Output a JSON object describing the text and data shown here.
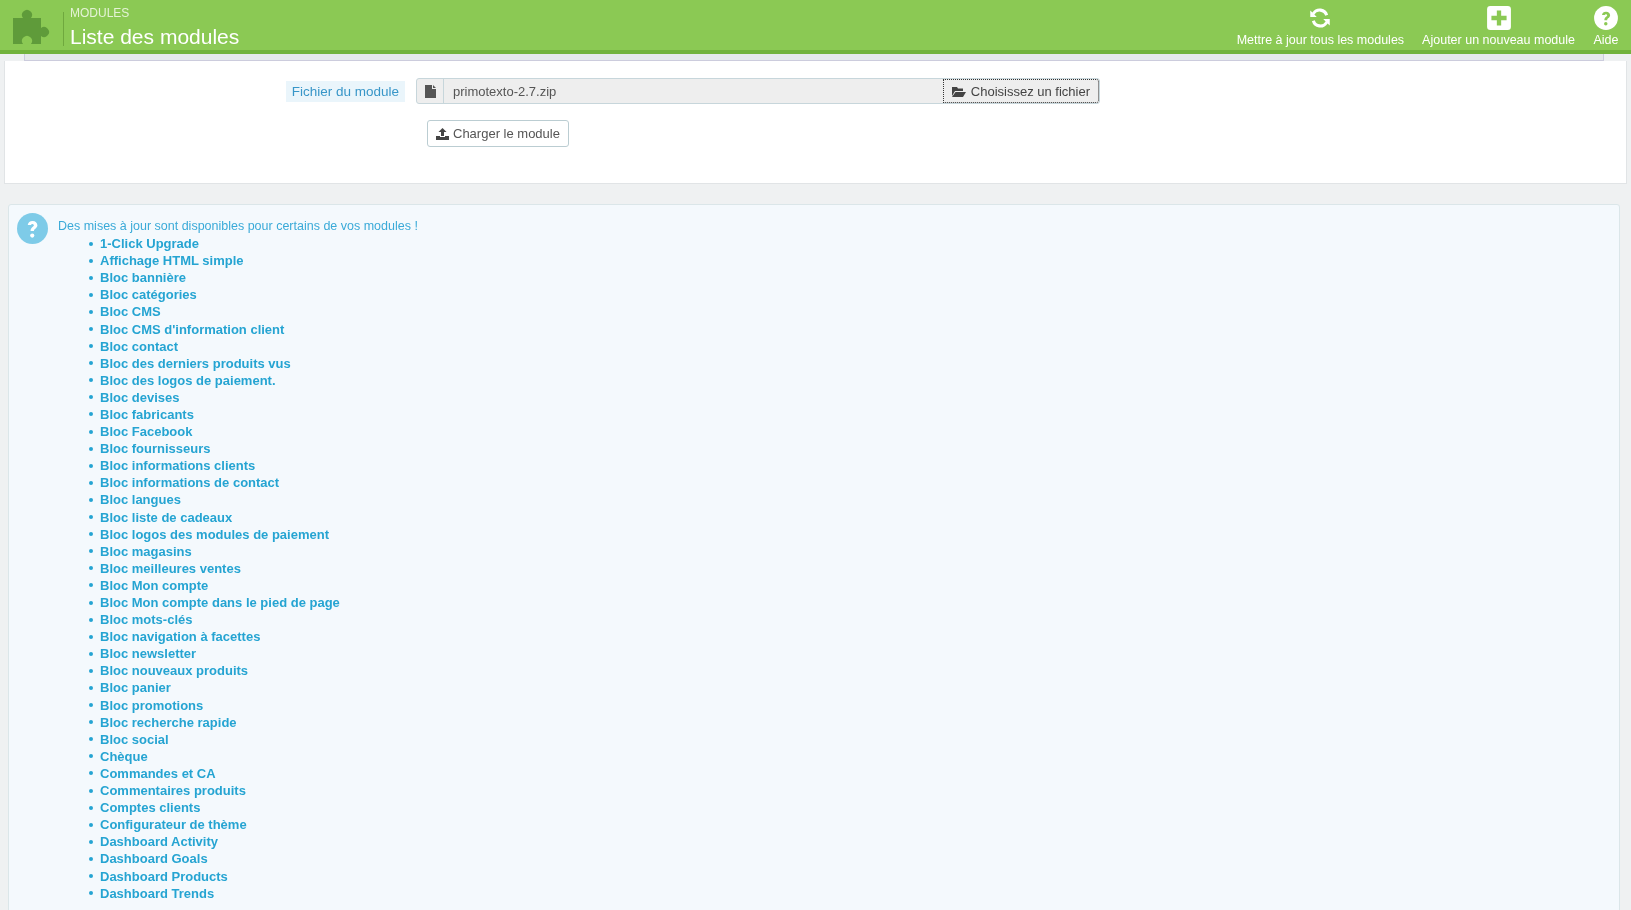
{
  "header": {
    "breadcrumb": "MODULES",
    "title": "Liste des modules",
    "toolbar": [
      {
        "kind": "refresh",
        "label": "Mettre à jour tous les modules"
      },
      {
        "kind": "add",
        "label": "Ajouter un nouveau module"
      },
      {
        "kind": "help",
        "label": "Aide"
      }
    ]
  },
  "upload_form": {
    "label": "Fichier du module",
    "file_value": "primotexto-2.7.zip",
    "choose_button": "Choisissez un fichier",
    "upload_button": "Charger le module"
  },
  "updates_notice": {
    "message": "Des mises à jour sont disponibles pour certains de vos modules !",
    "modules": [
      "1-Click Upgrade",
      "Affichage HTML simple",
      "Bloc bannière",
      "Bloc catégories",
      "Bloc CMS",
      "Bloc CMS d'information client",
      "Bloc contact",
      "Bloc des derniers produits vus",
      "Bloc des logos de paiement.",
      "Bloc devises",
      "Bloc fabricants",
      "Bloc Facebook",
      "Bloc fournisseurs",
      "Bloc informations clients",
      "Bloc informations de contact",
      "Bloc langues",
      "Bloc liste de cadeaux",
      "Bloc logos des modules de paiement",
      "Bloc magasins",
      "Bloc meilleures ventes",
      "Bloc Mon compte",
      "Bloc Mon compte dans le pied de page",
      "Bloc mots-clés",
      "Bloc navigation à facettes",
      "Bloc newsletter",
      "Bloc nouveaux produits",
      "Bloc panier",
      "Bloc promotions",
      "Bloc recherche rapide",
      "Bloc social",
      "Chèque",
      "Commandes et CA",
      "Commentaires produits",
      "Comptes clients",
      "Configurateur de thème",
      "Dashboard Activity",
      "Dashboard Goals",
      "Dashboard Products",
      "Dashboard Trends"
    ]
  }
}
